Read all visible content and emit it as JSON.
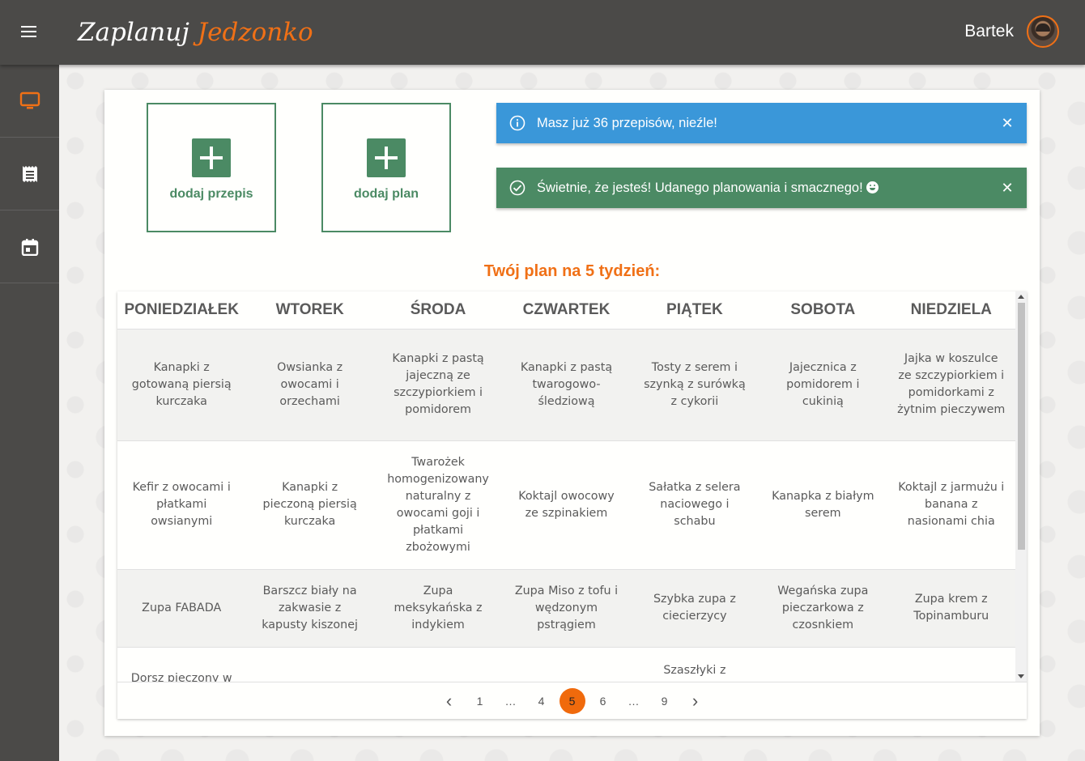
{
  "header": {
    "logo_part1": "Zaplanuj",
    "logo_part2": "Jedzonko",
    "username": "Bartek"
  },
  "sidebar": {
    "items": [
      {
        "icon": "monitor-icon",
        "active": true
      },
      {
        "icon": "receipt-icon",
        "active": false
      },
      {
        "icon": "calendar-icon",
        "active": false
      }
    ]
  },
  "actions": {
    "add_recipe_label": "dodaj przepis",
    "add_plan_label": "dodaj plan"
  },
  "alerts": {
    "info_text": "Masz już 36 przepisów, nieźle!",
    "success_text": "Świetnie, że jesteś! Udanego planowania i smacznego!"
  },
  "plan": {
    "title": "Twój plan na 5 tydzień:",
    "days": [
      "PONIEDZIAŁEK",
      "WTOREK",
      "ŚRODA",
      "CZWARTEK",
      "PIĄTEK",
      "SOBOTA",
      "NIEDZIELA"
    ],
    "rows": [
      [
        "Kanapki z gotowaną piersią kurczaka",
        "Owsianka z owocami i orzechami",
        "Kanapki z pastą jajeczną ze szczypiorkiem i pomidorem",
        "Kanapki z pastą twarogowo-śledziową",
        "Tosty z serem i szynką z surówką z cykorii",
        "Jajecznica z pomidorem i cukinią",
        "Jajka w koszulce ze szczypiorkiem i pomidorkami z żytnim pieczywem"
      ],
      [
        "Kefir z owocami i płatkami owsianymi",
        "Kanapki z pieczoną piersią kurczaka",
        "Twarożek homogenizowany naturalny z owocami goji i płatkami zbożowymi",
        "Koktajl owocowy ze szpinakiem",
        "Sałatka z selera naciowego i schabu",
        "Kanapka z białym serem",
        "Koktajl z jarmużu i banana z nasionami chia"
      ],
      [
        "Zupa FABADA",
        "Barszcz biały na zakwasie z kapusty kiszonej",
        "Zupa meksykańska z indykiem",
        "Zupa Miso z tofu i wędzonym pstrągiem",
        "Szybka zupa z ciecierzycy",
        "Wegańska zupa pieczarkowa z czosnkiem",
        "Zupa krem z Topinamburu"
      ],
      [
        "Dorsz pieczony w",
        "",
        "",
        "",
        "Szaszłyki z",
        "",
        ""
      ]
    ]
  },
  "pagination": {
    "prev": "‹",
    "next": "›",
    "pages": [
      "1",
      "…",
      "4",
      "5",
      "6",
      "…",
      "9"
    ],
    "current": "5"
  },
  "colors": {
    "accent": "#f07016",
    "green": "#4b8a64",
    "info": "#3a97d9",
    "dark": "#4b4a48"
  }
}
